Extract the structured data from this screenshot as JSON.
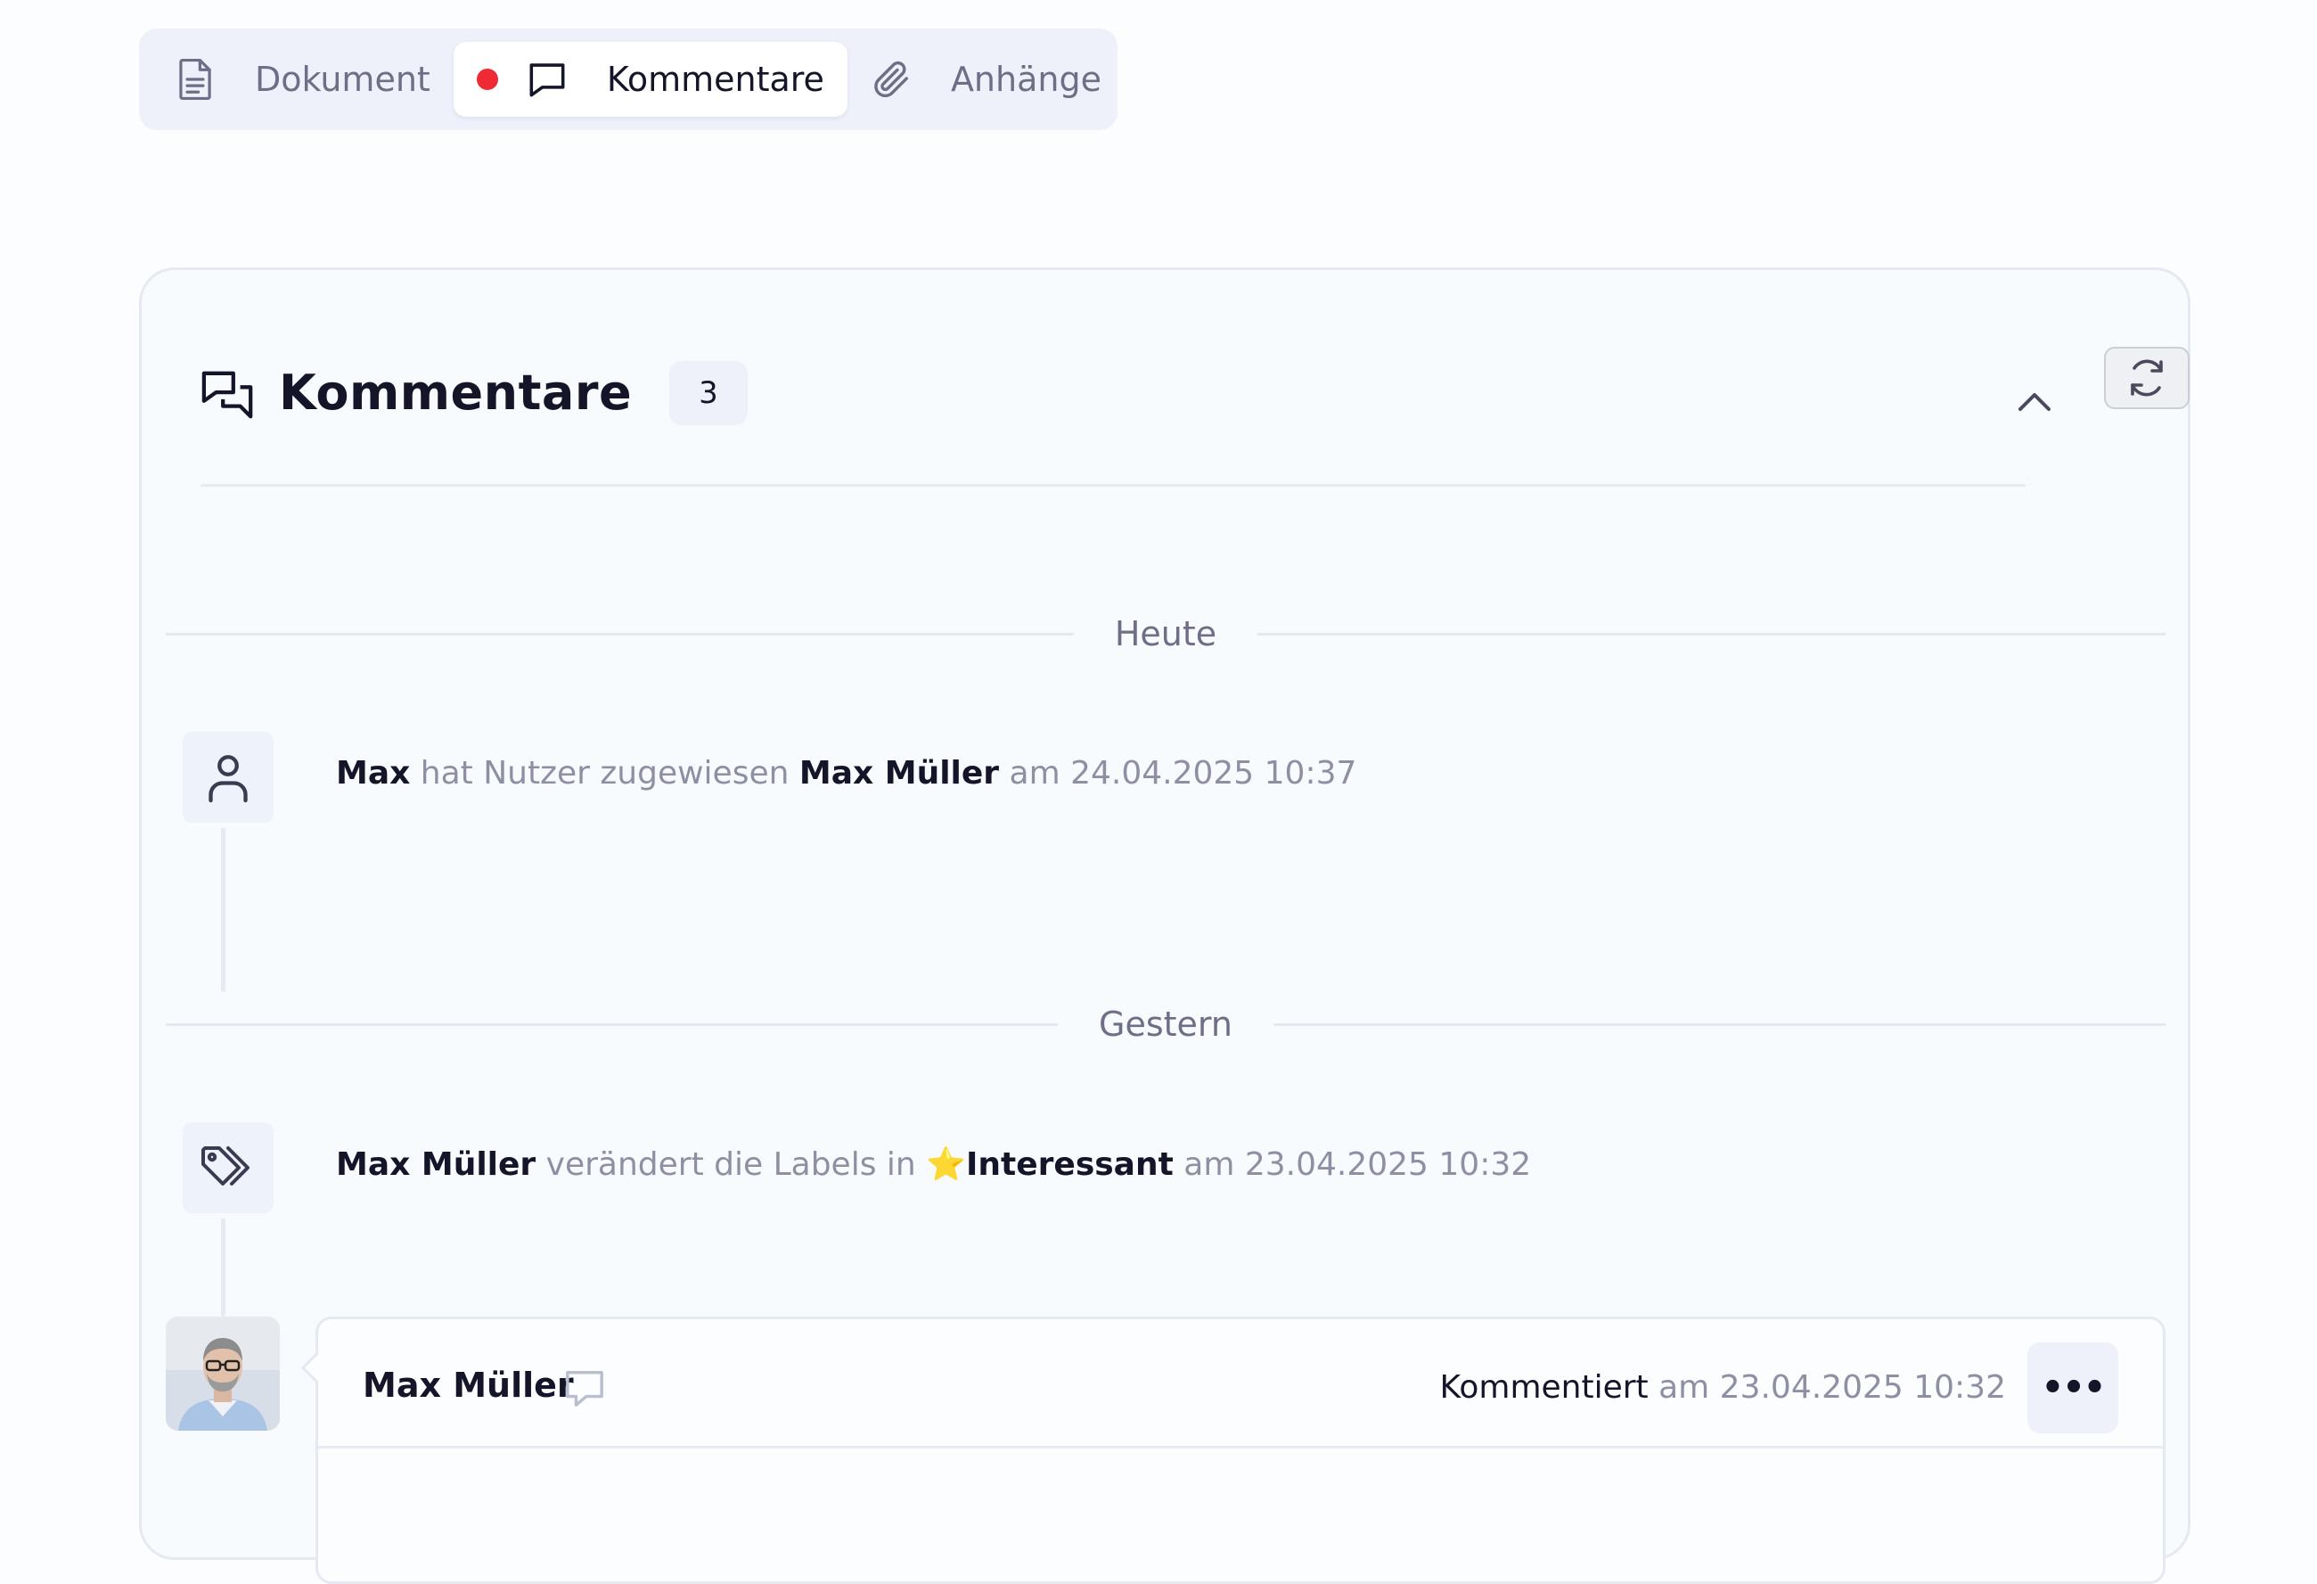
{
  "tabs": [
    {
      "label": "Dokument",
      "icon": "document-icon"
    },
    {
      "label": "Kommentare",
      "icon": "comment-icon",
      "active": true,
      "has_indicator": true
    },
    {
      "label": "Anhänge",
      "icon": "paperclip-icon"
    }
  ],
  "panel": {
    "title": "Kommentare",
    "count": "3"
  },
  "days": {
    "today": "Heute",
    "yesterday": "Gestern"
  },
  "activities": {
    "assign": {
      "actor": "Max",
      "action": "hat Nutzer zugewiesen",
      "target": "Max Müller",
      "meta": "am 24.04.2025 10:37"
    },
    "labels": {
      "actor": "Max Müller",
      "action": "verändert die Labels in",
      "emoji": "⭐",
      "target": "Interessant",
      "meta": "am 23.04.2025 10:32"
    }
  },
  "comment": {
    "author": "Max Müller",
    "verb": "Kommentiert",
    "meta": "am 23.04.2025 10:32",
    "more_label": "•••"
  },
  "colors": {
    "accent_indicator": "#ee2a35",
    "text_primary": "#15152a",
    "text_muted": "#8d90a3",
    "tab_bg": "#eef1fa"
  }
}
